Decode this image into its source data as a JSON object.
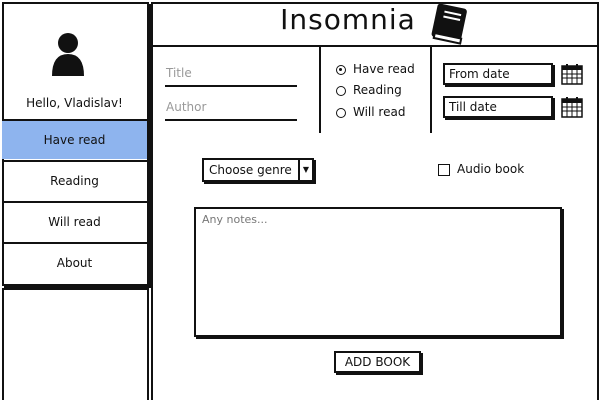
{
  "app": {
    "title": "Insomnia",
    "logo_icon": "book-icon"
  },
  "sidebar": {
    "avatar_icon": "user-icon",
    "greeting": "Hello, Vladislav!",
    "items": [
      {
        "label": "Have read",
        "active": true
      },
      {
        "label": "Reading",
        "active": false
      },
      {
        "label": "Will read",
        "active": false
      },
      {
        "label": "About",
        "active": false
      }
    ]
  },
  "form": {
    "title_placeholder": "Title",
    "author_placeholder": "Author",
    "status_options": [
      {
        "label": "Have read",
        "selected": true
      },
      {
        "label": "Reading",
        "selected": false
      },
      {
        "label": "Will read",
        "selected": false
      }
    ],
    "from_date_placeholder": "From date",
    "till_date_placeholder": "Till date",
    "genre_select": "Choose genre",
    "audio_book_label": "Audio book",
    "audio_book_checked": false,
    "notes_placeholder": "Any notes...",
    "add_button_label": "ADD BOOK"
  },
  "colors": {
    "active_nav": "#8eb4ee"
  }
}
